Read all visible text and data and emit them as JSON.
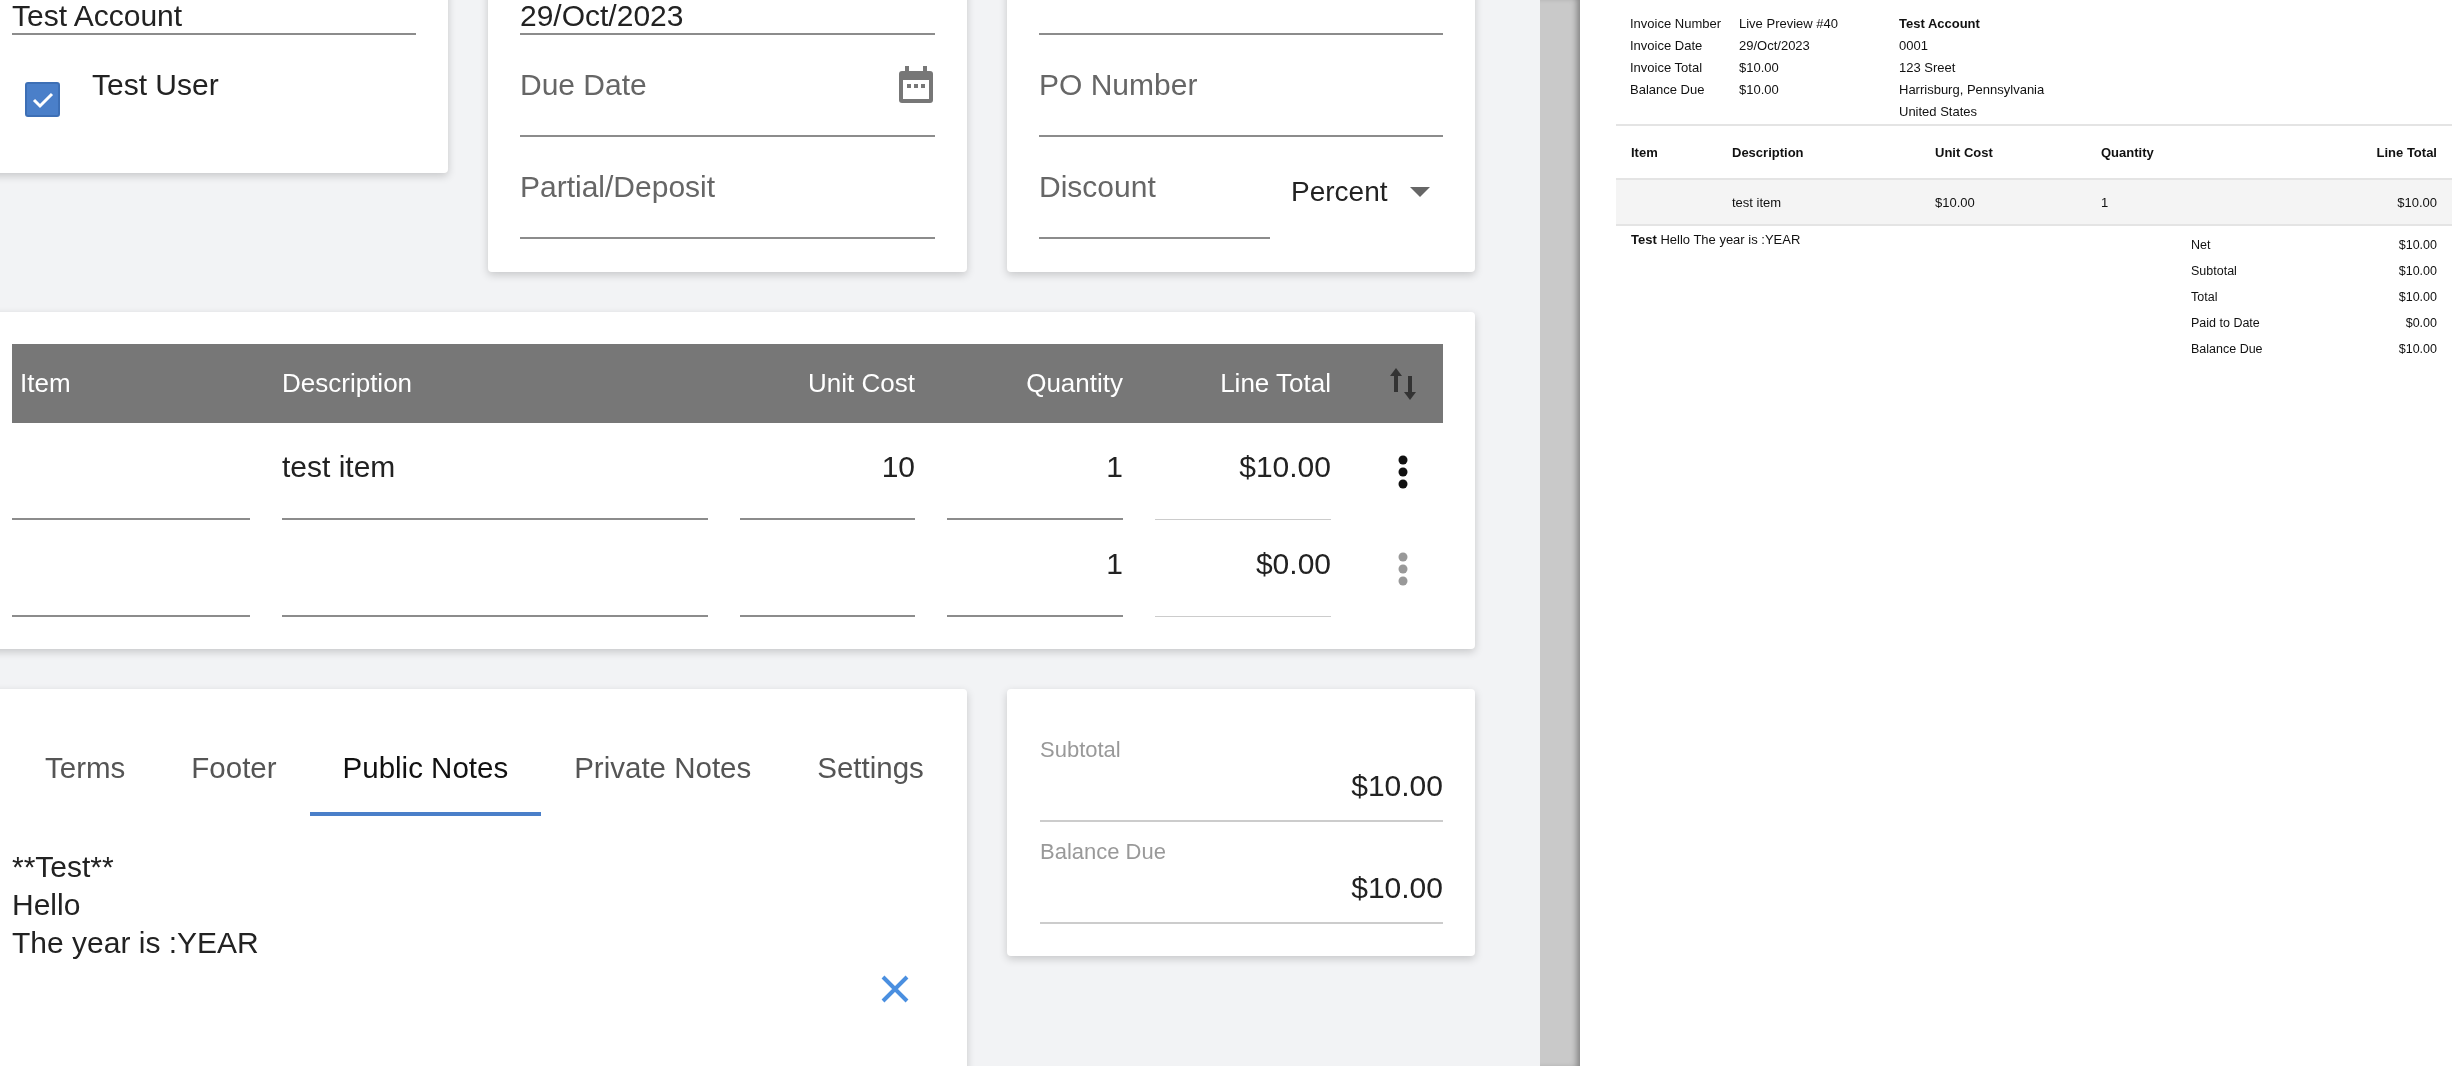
{
  "client_card": {
    "client": {
      "value": "Test Account"
    },
    "contacts": [
      {
        "name": "Test User",
        "checked": true
      }
    ]
  },
  "dates_card": {
    "date": {
      "value": "29/Oct/2023"
    },
    "due_date": {
      "placeholder": "Due Date"
    },
    "partial_deposit": {
      "placeholder": "Partial/Deposit"
    }
  },
  "details_card": {
    "po_number": {
      "placeholder": "PO Number"
    },
    "discount": {
      "placeholder": "Discount"
    },
    "discount_type": "Percent"
  },
  "line_items": {
    "columns": [
      {
        "label": "Item",
        "kind": "text"
      },
      {
        "label": "Description",
        "kind": "text"
      },
      {
        "label": "Unit Cost",
        "kind": "number"
      },
      {
        "label": "Quantity",
        "kind": "number"
      },
      {
        "label": "Line Total",
        "kind": "number"
      }
    ],
    "rows": [
      {
        "description": "test item",
        "unit_cost": "10",
        "quantity": "1",
        "line_total": "$10.00",
        "disabled": false
      },
      {
        "quantity": "1",
        "line_total": "$0.00",
        "disabled": true
      }
    ]
  },
  "notes_card": {
    "tabs": [
      {
        "label": "Terms",
        "selected": false
      },
      {
        "label": "Footer",
        "selected": false
      },
      {
        "label": "Public Notes",
        "selected": true
      },
      {
        "label": "Private Notes",
        "selected": false
      },
      {
        "label": "Settings",
        "selected": false
      }
    ],
    "text": "**Test**\nHello\nThe year is :YEAR"
  },
  "totals_card": [
    {
      "label": "Subtotal",
      "value": "$10.00"
    },
    {
      "label": "Balance Due",
      "value": "$10.00"
    }
  ],
  "preview": {
    "meta": [
      {
        "label": "Invoice Number",
        "value": "Live Preview #40"
      },
      {
        "label": "Invoice Date",
        "value": "29/Oct/2023"
      },
      {
        "label": "Invoice Total",
        "value": "$10.00"
      },
      {
        "label": "Balance Due",
        "value": "$10.00"
      }
    ],
    "client": {
      "name": "Test Account",
      "lines": [
        "0001",
        "123 Sreet",
        "Harrisburg, Pennsylvania",
        "United States"
      ]
    },
    "columns": [
      {
        "label": "Item",
        "kind": "text"
      },
      {
        "label": "Description",
        "kind": "text"
      },
      {
        "label": "Unit Cost",
        "kind": "text"
      },
      {
        "label": "Quantity",
        "kind": "text"
      },
      {
        "label": "Line Total",
        "kind": "number"
      }
    ],
    "rows": [
      {
        "description": "test item",
        "unit_cost": "$10.00",
        "quantity": "1",
        "line_total": "$10.00"
      }
    ],
    "notes": "**Test** Hello The year is :YEAR",
    "totals": [
      {
        "label": "Net",
        "value": "$10.00"
      },
      {
        "label": "Subtotal",
        "value": "$10.00"
      },
      {
        "label": "Total",
        "value": "$10.00"
      },
      {
        "label": "Paid to Date",
        "value": "$0.00"
      },
      {
        "label": "Balance Due",
        "value": "$10.00"
      }
    ]
  }
}
